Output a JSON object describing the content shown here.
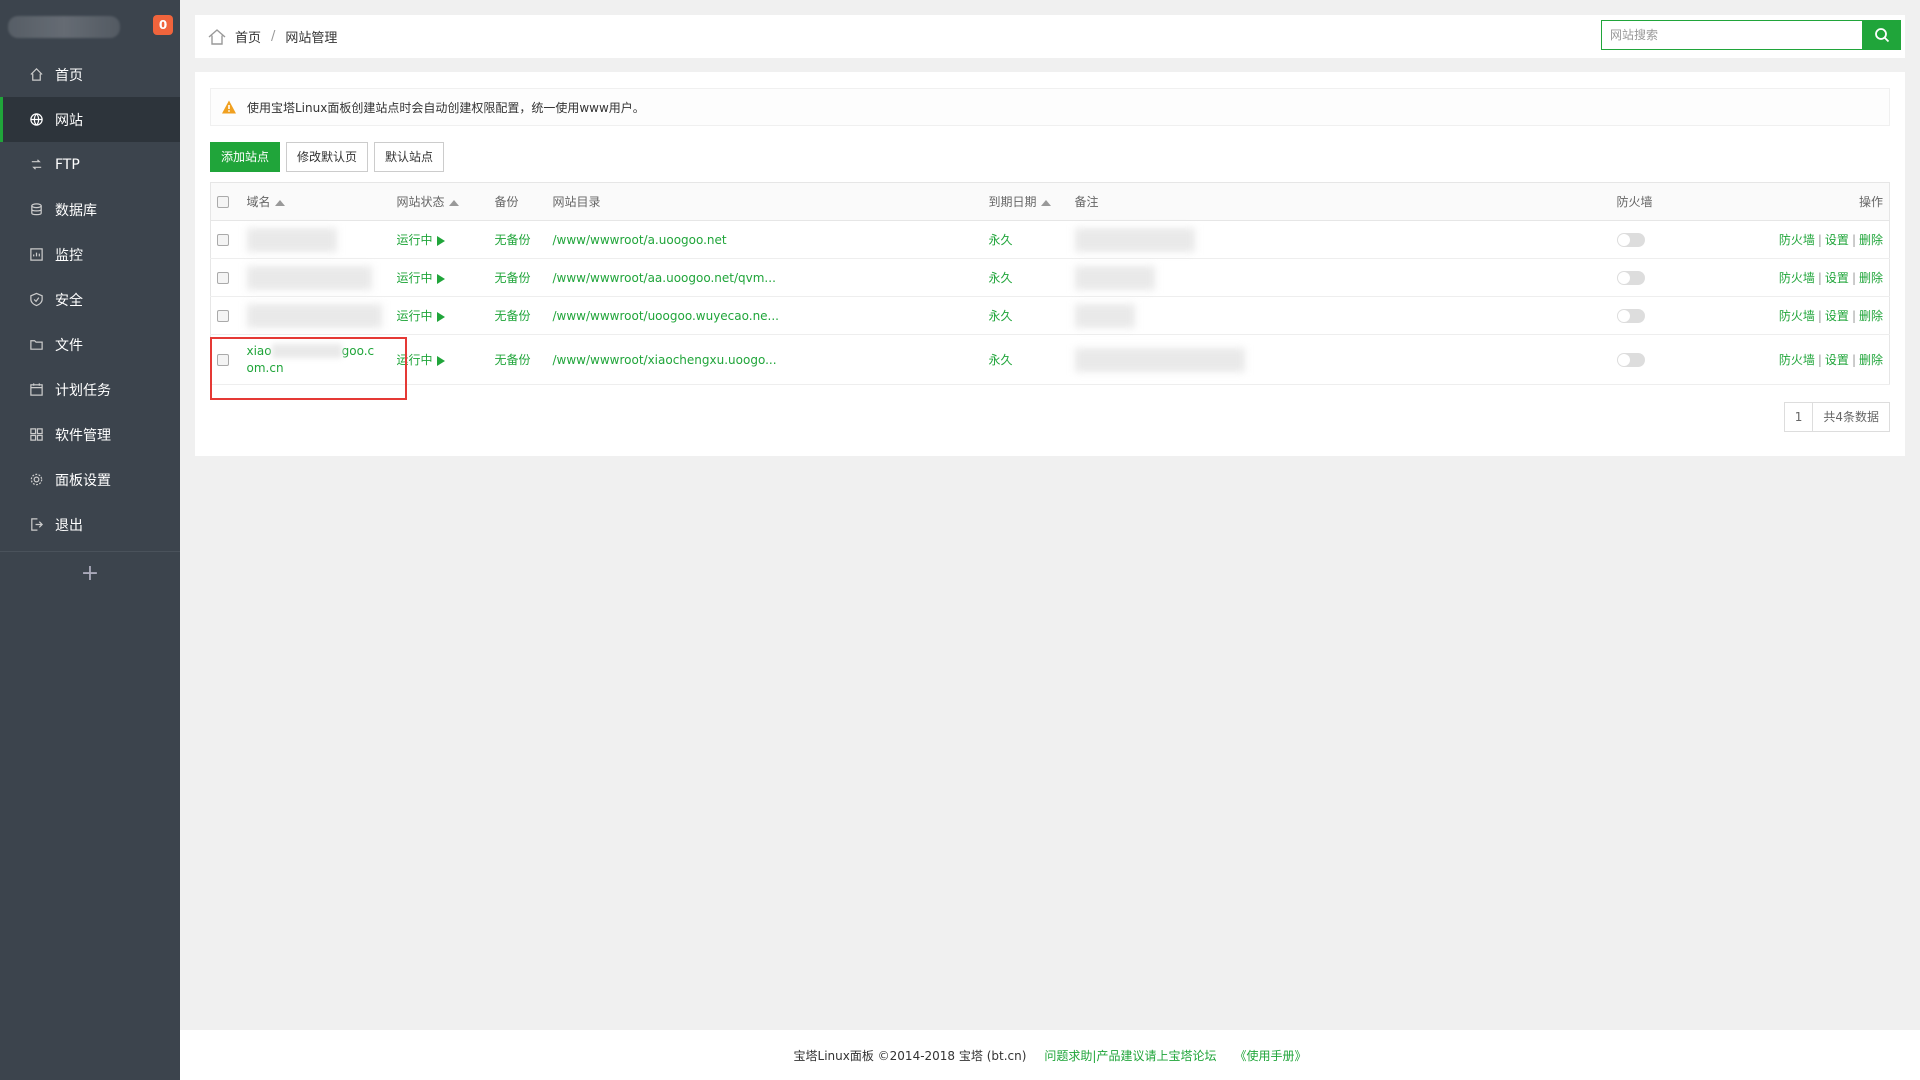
{
  "sidebar": {
    "badge": "0",
    "items": [
      {
        "label": "首页",
        "icon": "home-icon"
      },
      {
        "label": "网站",
        "icon": "globe-icon"
      },
      {
        "label": "FTP",
        "icon": "ftp-icon"
      },
      {
        "label": "数据库",
        "icon": "database-icon"
      },
      {
        "label": "监控",
        "icon": "monitor-icon"
      },
      {
        "label": "安全",
        "icon": "shield-icon"
      },
      {
        "label": "文件",
        "icon": "folder-icon"
      },
      {
        "label": "计划任务",
        "icon": "calendar-icon"
      },
      {
        "label": "软件管理",
        "icon": "grid-icon"
      },
      {
        "label": "面板设置",
        "icon": "gear-icon"
      },
      {
        "label": "退出",
        "icon": "logout-icon"
      }
    ],
    "add": "+"
  },
  "breadcrumb": {
    "home": "首页",
    "sep": "/",
    "current": "网站管理"
  },
  "search": {
    "placeholder": "网站搜索"
  },
  "alert": {
    "text": "使用宝塔Linux面板创建站点时会自动创建权限配置，统一使用www用户。"
  },
  "buttons": {
    "add": "添加站点",
    "edit_default": "修改默认页",
    "default_site": "默认站点"
  },
  "table": {
    "headers": {
      "domain": "域名",
      "status": "网站状态",
      "backup": "备份",
      "dir": "网站目录",
      "expire": "到期日期",
      "note": "备注",
      "firewall": "防火墙",
      "ops": "操作"
    },
    "rows": [
      {
        "status": "运行中",
        "backup": "无备份",
        "dir": "/www/wwwroot/a.uoogoo.net",
        "expire": "永久"
      },
      {
        "status": "运行中",
        "backup": "无备份",
        "dir": "/www/wwwroot/aa.uoogoo.net/qvm...",
        "expire": "永久"
      },
      {
        "status": "运行中",
        "backup": "无备份",
        "dir": "/www/wwwroot/uoogoo.wuyecao.ne...",
        "expire": "永久"
      },
      {
        "domain_a": "xiao",
        "domain_b": "goo.c",
        "domain_c": "om.cn",
        "status": "运行中",
        "backup": "无备份",
        "dir": "/www/wwwroot/xiaochengxu.uoogo...",
        "expire": "永久"
      }
    ],
    "ops": {
      "firewall": "防火墙",
      "settings": "设置",
      "delete": "删除",
      "sep": "|"
    }
  },
  "pager": {
    "page": "1",
    "total": "共4条数据"
  },
  "footer": {
    "copyright": "宝塔Linux面板 ©2014-2018 宝塔 (bt.cn)",
    "help": "问题求助|产品建议请上宝塔论坛",
    "manual": "《使用手册》"
  },
  "colors": {
    "accent": "#20a53a",
    "sidebar": "#3c444d",
    "badge": "#f0643c",
    "highlight": "#e53935"
  }
}
